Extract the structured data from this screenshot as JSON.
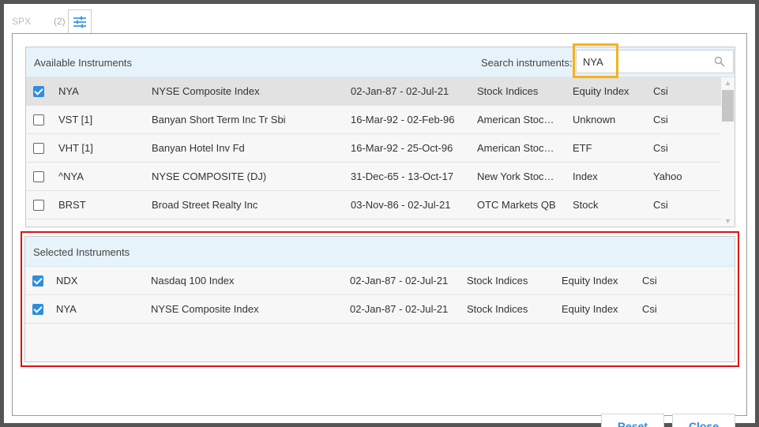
{
  "topbar": {
    "symbol": "SPX",
    "count": "(2)"
  },
  "available": {
    "title": "Available Instruments",
    "search_label": "Search instruments:",
    "search_value": "NYA",
    "rows": [
      {
        "checked": true,
        "symbol": "NYA",
        "name": "NYSE Composite Index",
        "range": "02-Jan-87 - 02-Jul-21",
        "exchange": "Stock Indices",
        "type": "Equity Index",
        "source": "Csi"
      },
      {
        "checked": false,
        "symbol": "VST [1]",
        "name": "Banyan Short Term Inc Tr Sbi",
        "range": "16-Mar-92 - 02-Feb-96",
        "exchange": "American Stoc…",
        "type": "Unknown",
        "source": "Csi"
      },
      {
        "checked": false,
        "symbol": "VHT [1]",
        "name": "Banyan Hotel Inv Fd",
        "range": "16-Mar-92 - 25-Oct-96",
        "exchange": "American Stoc…",
        "type": "ETF",
        "source": "Csi"
      },
      {
        "checked": false,
        "symbol": "^NYA",
        "name": "NYSE COMPOSITE (DJ)",
        "range": "31-Dec-65 - 13-Oct-17",
        "exchange": "New York Stoc…",
        "type": "Index",
        "source": "Yahoo"
      },
      {
        "checked": false,
        "symbol": "BRST",
        "name": "Broad Street Realty Inc",
        "range": "03-Nov-86 - 02-Jul-21",
        "exchange": "OTC Markets QB",
        "type": "Stock",
        "source": "Csi"
      }
    ]
  },
  "selected": {
    "title": "Selected Instruments",
    "rows": [
      {
        "checked": true,
        "symbol": "NDX",
        "name": "Nasdaq 100 Index",
        "range": "02-Jan-87 - 02-Jul-21",
        "exchange": "Stock Indices",
        "type": "Equity Index",
        "source": "Csi"
      },
      {
        "checked": true,
        "symbol": "NYA",
        "name": "NYSE Composite Index",
        "range": "02-Jan-87 - 02-Jul-21",
        "exchange": "Stock Indices",
        "type": "Equity Index",
        "source": "Csi"
      }
    ]
  },
  "footer": {
    "reset_label": "Reset",
    "close_label": "Close"
  },
  "colors": {
    "accent": "#2e8ede",
    "search_highlight": "#f7b21b",
    "selected_highlight": "#e01010"
  }
}
